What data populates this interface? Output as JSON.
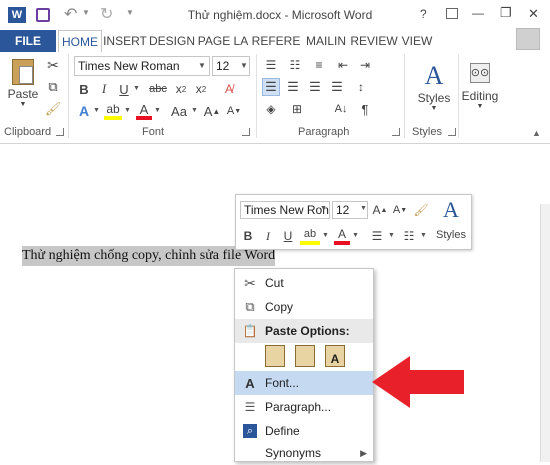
{
  "window": {
    "title": "Thử nghiệm.docx - Microsoft Word",
    "help": "?",
    "minimize": "—",
    "maximize": "❐",
    "close": "✕"
  },
  "tabs": [
    {
      "label": "FILE"
    },
    {
      "label": "HOME"
    },
    {
      "label": "INSERT"
    },
    {
      "label": "DESIGN"
    },
    {
      "label": "PAGE LA"
    },
    {
      "label": "REFERE"
    },
    {
      "label": "MAILIN"
    },
    {
      "label": "REVIEW"
    },
    {
      "label": "VIEW"
    }
  ],
  "ribbon": {
    "clipboard": {
      "paste": "Paste",
      "label": "Clipboard"
    },
    "font": {
      "name": "Times New Roman",
      "size": "12",
      "label": "Font"
    },
    "paragraph": {
      "label": "Paragraph"
    },
    "styles": {
      "button": "Styles",
      "label": "Styles"
    },
    "editing": {
      "button": "Editing"
    }
  },
  "document": {
    "selected_text": "Thử nghiệm chống copy, chỉnh sửa file Word"
  },
  "mini_toolbar": {
    "font_name": "Times New Ron",
    "font_size": "12",
    "styles": "Styles"
  },
  "context_menu": {
    "items": [
      {
        "label": "Cut",
        "icon": "scissors-icon"
      },
      {
        "label": "Copy",
        "icon": "copy-icon"
      },
      {
        "label": "Paste Options:",
        "icon": "paste-icon",
        "header": true
      },
      {
        "label": "Font...",
        "icon": "font-icon",
        "highlight": true
      },
      {
        "label": "Paragraph...",
        "icon": "paragraph-icon"
      },
      {
        "label": "Define",
        "icon": "define-icon"
      },
      {
        "label": "Synonyms",
        "icon": "",
        "submenu": true
      }
    ]
  },
  "colors": {
    "accent": "#2b579a",
    "highlight_menu": "#c5d9f1",
    "arrow": "#e8202a",
    "selection": "#c7c7c7"
  }
}
